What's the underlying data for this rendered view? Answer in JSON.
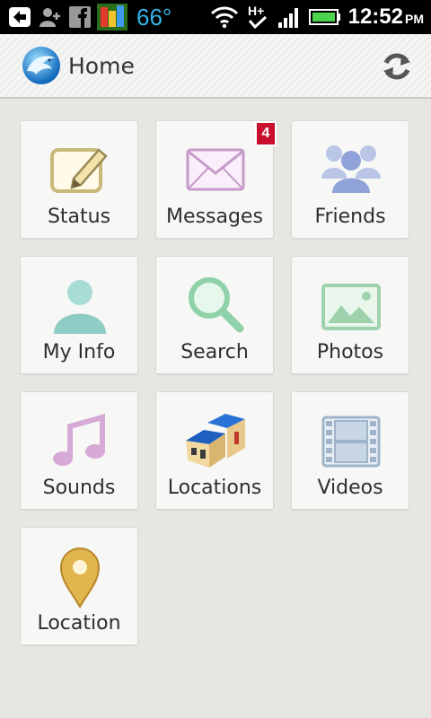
{
  "status_bar": {
    "temperature": "66°",
    "time": "12:52",
    "ampm": "PM",
    "network": "H+"
  },
  "header": {
    "title": "Home",
    "logo_icon": "dolphin-logo-icon",
    "refresh_icon": "refresh-icon"
  },
  "tiles": [
    {
      "label": "Status",
      "icon": "edit-note-icon"
    },
    {
      "label": "Messages",
      "icon": "envelope-icon",
      "badge": "4"
    },
    {
      "label": "Friends",
      "icon": "friends-group-icon"
    },
    {
      "label": "My Info",
      "icon": "person-icon"
    },
    {
      "label": "Search",
      "icon": "magnifier-icon"
    },
    {
      "label": "Photos",
      "icon": "photo-icon"
    },
    {
      "label": "Sounds",
      "icon": "music-note-icon"
    },
    {
      "label": "Locations",
      "icon": "buildings-icon"
    },
    {
      "label": "Videos",
      "icon": "film-strip-icon"
    },
    {
      "label": "Location",
      "icon": "map-pin-icon"
    }
  ],
  "colors": {
    "badge": "#c8102e",
    "temp_text": "#33b5e5",
    "battery": "#4cd24c"
  }
}
